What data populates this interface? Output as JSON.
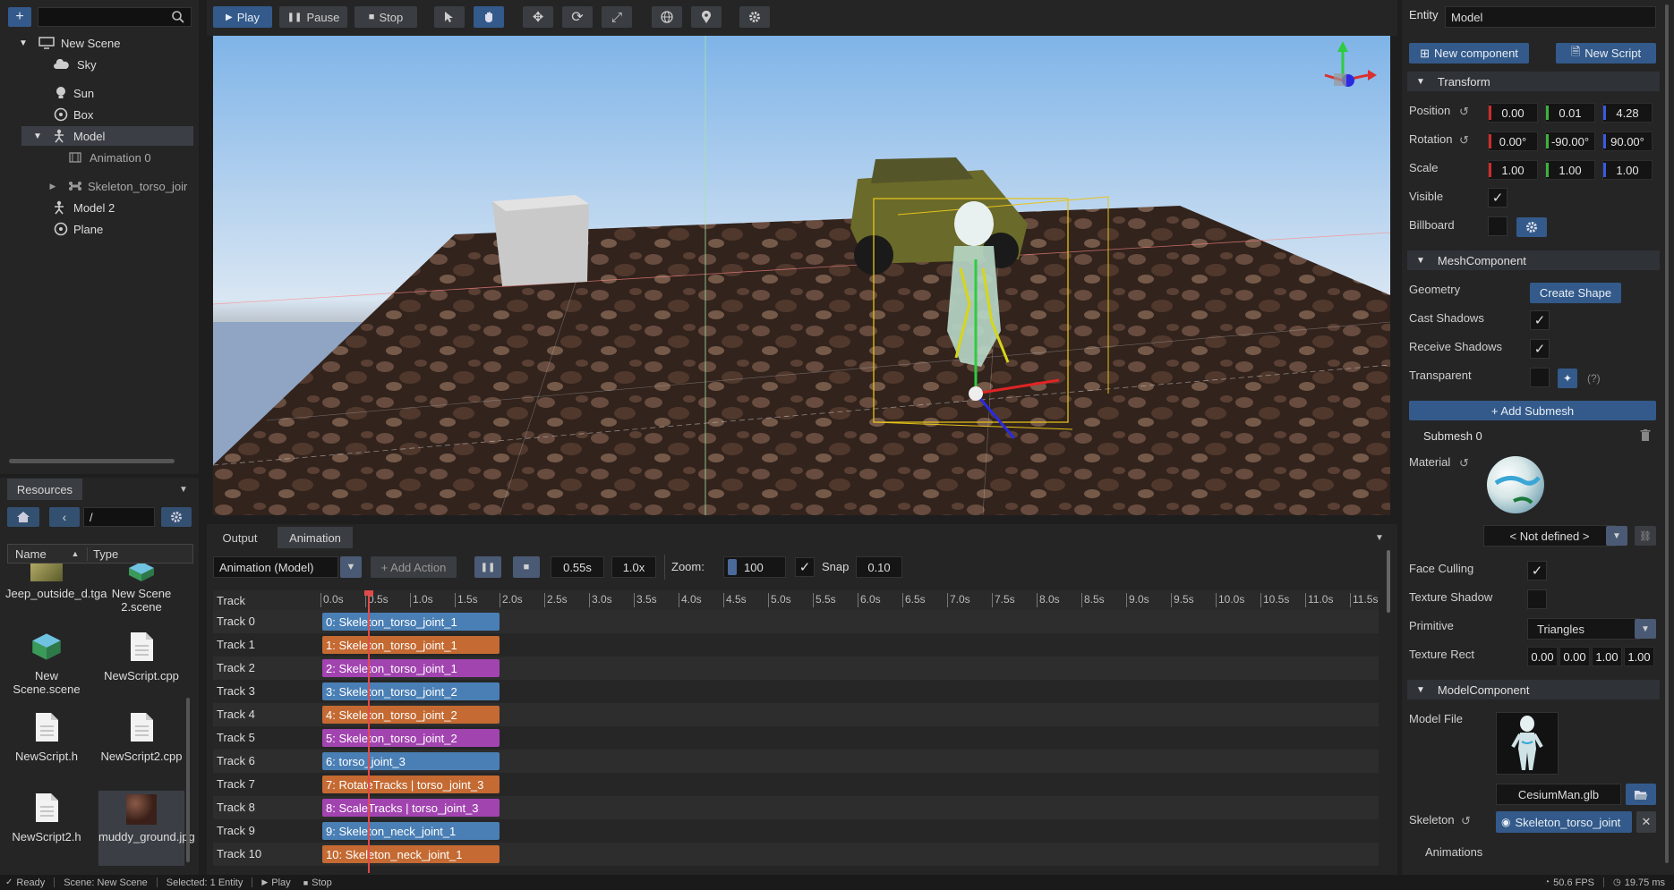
{
  "toolbar": {
    "play": "Play",
    "pause": "Pause",
    "stop": "Stop"
  },
  "scene_tree": {
    "items": [
      {
        "label": "New Scene",
        "icon": "monitor-icon"
      },
      {
        "label": "Sky",
        "icon": "cloud-icon"
      },
      {
        "label": "Sun",
        "icon": "bulb-icon"
      },
      {
        "label": "Box",
        "icon": "mesh-icon"
      },
      {
        "label": "Model",
        "icon": "person-icon"
      },
      {
        "label": "Animation 0",
        "icon": "film-icon"
      },
      {
        "label": "Skeleton_torso_joir",
        "icon": "bone-icon"
      },
      {
        "label": "Model 2",
        "icon": "person-icon"
      },
      {
        "label": "Plane",
        "icon": "mesh-icon"
      }
    ]
  },
  "resources": {
    "tab": "Resources",
    "path": "/",
    "col_name": "Name",
    "col_type": "Type",
    "items": [
      {
        "label": "Jeep_outside_d.tga"
      },
      {
        "label": "New Scene 2.scene"
      },
      {
        "label": "New Scene.scene"
      },
      {
        "label": "NewScript.cpp"
      },
      {
        "label": "NewScript.h"
      },
      {
        "label": "NewScript2.cpp"
      },
      {
        "label": "NewScript2.h"
      },
      {
        "label": "muddy_ground.jpg"
      }
    ]
  },
  "bottom_tabs": {
    "output": "Output",
    "animation": "Animation"
  },
  "animation": {
    "selector": "Animation (Model)",
    "add_action": "+ Add Action",
    "time": "0.55s",
    "speed": "1.0x",
    "zoom_label": "Zoom:",
    "zoom": "100",
    "snap_label": "Snap",
    "snap": "0.10",
    "track_header": "Track",
    "ruler": [
      "0.0s",
      "0.5s",
      "1.0s",
      "1.5s",
      "2.0s",
      "2.5s",
      "3.0s",
      "3.5s",
      "4.0s",
      "4.5s",
      "5.0s",
      "5.5s",
      "6.0s",
      "6.5s",
      "7.0s",
      "7.5s",
      "8.0s",
      "8.5s",
      "9.0s",
      "9.5s",
      "10.0s",
      "10.5s",
      "11.0s",
      "11.5s"
    ],
    "tracks": [
      {
        "name": "Track 0",
        "clip": "0: Skeleton_torso_joint_1",
        "color": "#4a7fb5"
      },
      {
        "name": "Track 1",
        "clip": "1: Skeleton_torso_joint_1",
        "color": "#c46a32"
      },
      {
        "name": "Track 2",
        "clip": "2: Skeleton_torso_joint_1",
        "color": "#a244b0"
      },
      {
        "name": "Track 3",
        "clip": "3: Skeleton_torso_joint_2",
        "color": "#4a7fb5"
      },
      {
        "name": "Track 4",
        "clip": "4: Skeleton_torso_joint_2",
        "color": "#c46a32"
      },
      {
        "name": "Track 5",
        "clip": "5: Skeleton_torso_joint_2",
        "color": "#a244b0"
      },
      {
        "name": "Track 6",
        "clip": "6: torso_joint_3",
        "color": "#4a7fb5"
      },
      {
        "name": "Track 7",
        "clip": "7: RotateTracks | torso_joint_3",
        "color": "#c46a32"
      },
      {
        "name": "Track 8",
        "clip": "8: ScaleTracks | torso_joint_3",
        "color": "#a244b0"
      },
      {
        "name": "Track 9",
        "clip": "9: Skeleton_neck_joint_1",
        "color": "#4a7fb5"
      },
      {
        "name": "Track 10",
        "clip": "10: Skeleton_neck_joint_1",
        "color": "#c46a32"
      }
    ]
  },
  "inspector": {
    "entity_label": "Entity",
    "entity_name": "Model",
    "new_component": "New component",
    "new_script": "New Script",
    "transform": {
      "title": "Transform",
      "position_label": "Position",
      "position": [
        "0.00",
        "0.01",
        "4.28"
      ],
      "rotation_label": "Rotation",
      "rotation": [
        "0.00°",
        "-90.00°",
        "90.00°"
      ],
      "scale_label": "Scale",
      "scale": [
        "1.00",
        "1.00",
        "1.00"
      ],
      "visible_label": "Visible",
      "billboard_label": "Billboard"
    },
    "mesh": {
      "title": "MeshComponent",
      "geometry_label": "Geometry",
      "create_shape": "Create Shape",
      "cast_shadows": "Cast Shadows",
      "receive_shadows": "Receive Shadows",
      "transparent": "Transparent",
      "help": "(?)",
      "add_submesh": "+ Add Submesh",
      "submesh": "Submesh 0",
      "material_label": "Material",
      "material_value": "< Not defined >",
      "face_culling": "Face Culling",
      "texture_shadow": "Texture Shadow",
      "primitive_label": "Primitive",
      "primitive": "Triangles",
      "texture_rect_label": "Texture Rect",
      "texture_rect": [
        "0.00",
        "0.00",
        "1.00",
        "1.00"
      ]
    },
    "model": {
      "title": "ModelComponent",
      "model_file_label": "Model File",
      "model_file": "CesiumMan.glb",
      "skeleton_label": "Skeleton",
      "skeleton": "Skeleton_torso_joint",
      "animations_label": "Animations"
    }
  },
  "status": {
    "ready": "Ready",
    "scene": "Scene: New Scene",
    "selected": "Selected: 1 Entity",
    "play": "Play",
    "stop": "Stop",
    "fps": "50.6 FPS",
    "ms": "19.75 ms"
  },
  "colors": {
    "accent": "#335a8a",
    "playhead": "#e24a4a"
  }
}
